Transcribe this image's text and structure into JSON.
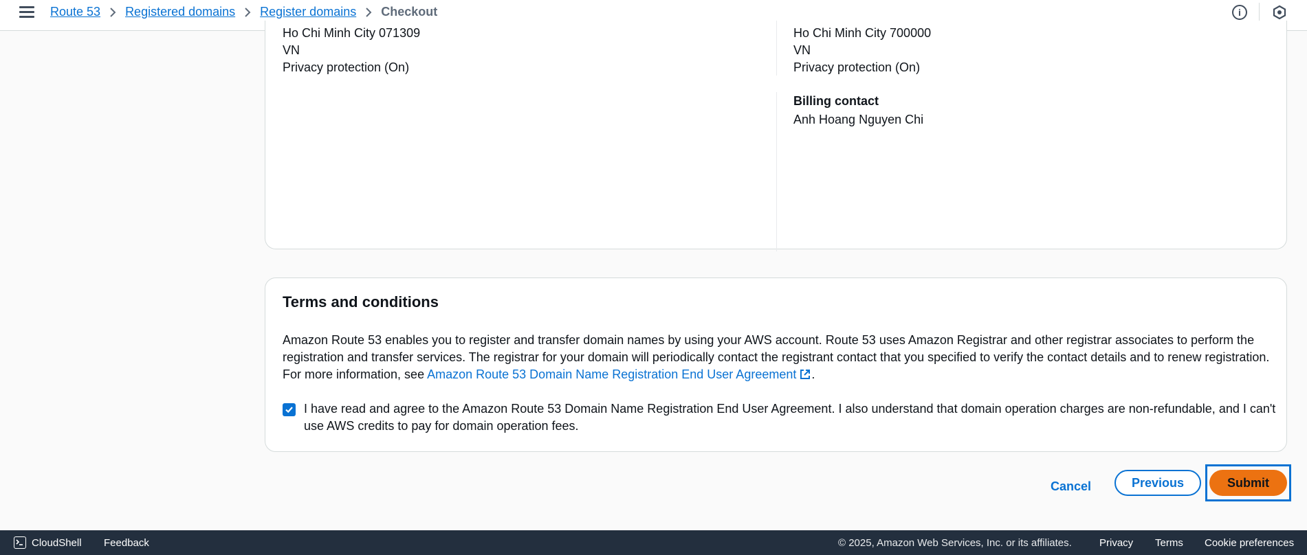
{
  "header": {
    "breadcrumbs": [
      {
        "label": "Route 53"
      },
      {
        "label": "Registered domains"
      },
      {
        "label": "Register domains"
      }
    ],
    "current": "Checkout",
    "info_icon": "info-icon",
    "profile_icon": "hexagon-icon"
  },
  "review": {
    "left": {
      "city": "Ho Chi Minh City 071309",
      "country": "VN",
      "privacy": "Privacy protection (On)"
    },
    "right": {
      "city": "Ho Chi Minh City 700000",
      "country": "VN",
      "privacy": "Privacy protection (On)"
    },
    "billing": {
      "label": "Billing contact",
      "name": "Anh Hoang Nguyen Chi"
    }
  },
  "terms": {
    "title": "Terms and conditions",
    "body": "Amazon Route 53 enables you to register and transfer domain names by using your AWS account. Route 53 uses Amazon Registrar and other registrar associates to perform the registration and transfer services. The registrar for your domain will periodically contact the registrant contact that you specified to verify the contact details and to renew registration. For more information, see ",
    "link": "Amazon Route 53 Domain Name Registration End User Agreement",
    "after_link": ".",
    "agree_checked": true,
    "agree_text": "I have read and agree to the Amazon Route 53 Domain Name Registration End User Agreement. I also understand that domain operation charges are non-refundable, and I can't use AWS credits to pay for domain operation fees."
  },
  "actions": {
    "cancel": "Cancel",
    "previous": "Previous",
    "submit": "Submit"
  },
  "footer": {
    "cloudshell": "CloudShell",
    "feedback": "Feedback",
    "copyright": "© 2025, Amazon Web Services, Inc. or its affiliates.",
    "privacy": "Privacy",
    "terms": "Terms",
    "cookies": "Cookie preferences"
  },
  "colors": {
    "link": "#0972d3",
    "submit": "#ec7211",
    "footer": "#232f3e"
  }
}
